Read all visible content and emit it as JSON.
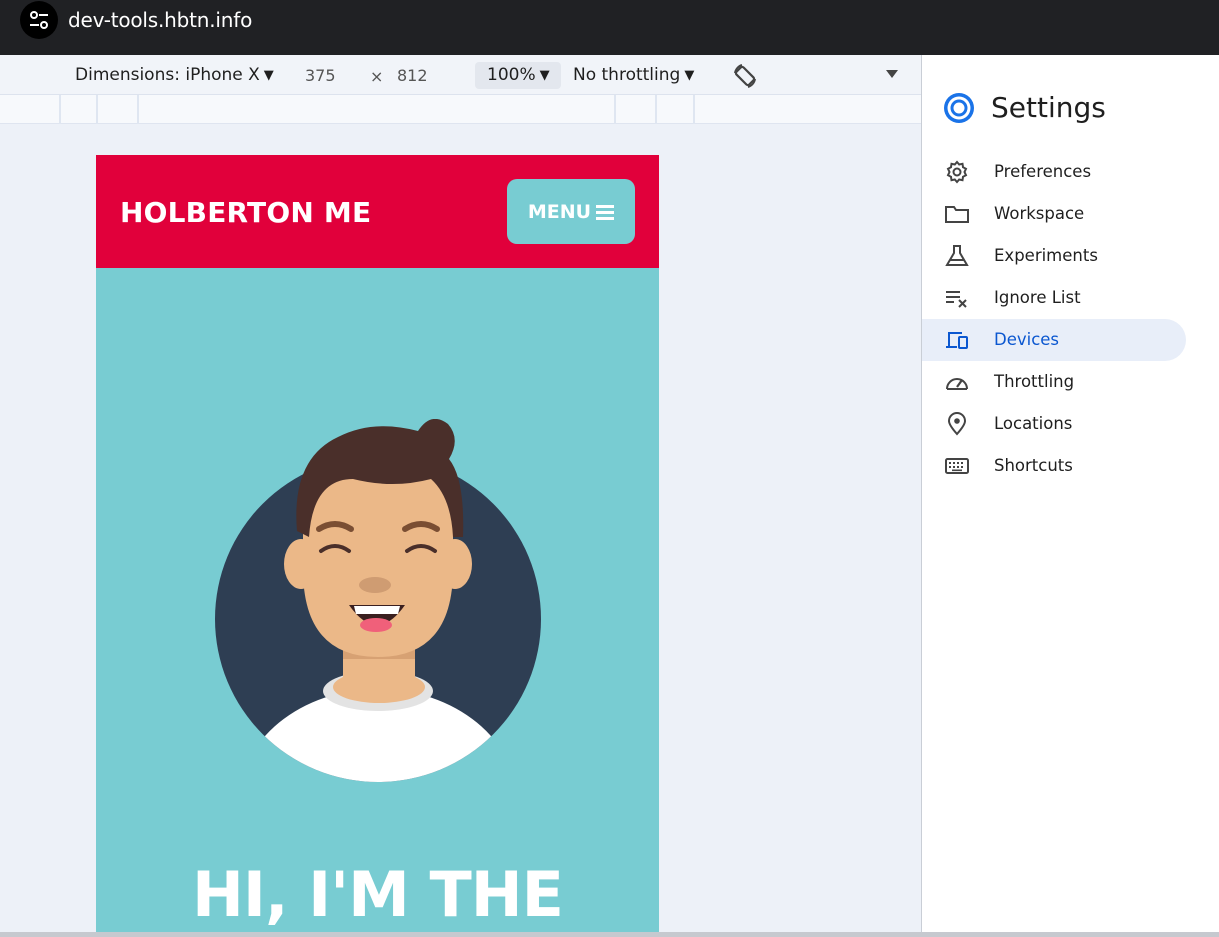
{
  "browser": {
    "url": "dev-tools.hbtn.info",
    "site_icon": "tune-icon"
  },
  "device_toolbar": {
    "dimensions_label": "Dimensions: iPhone X",
    "width": "375",
    "times": "×",
    "height": "812",
    "zoom": "100%",
    "throttling": "No throttling",
    "caret": "▼",
    "rotate_icon": "rotate-icon"
  },
  "page": {
    "logo": "HOLBERTON ME",
    "menu_label": "MENU",
    "hero_title": "HI, I'M THE",
    "colors": {
      "header": "#e1003b",
      "body": "#78ccd2"
    }
  },
  "settings": {
    "title": "Settings",
    "items": [
      {
        "label": "Preferences",
        "icon": "gear-icon"
      },
      {
        "label": "Workspace",
        "icon": "folder-icon"
      },
      {
        "label": "Experiments",
        "icon": "flask-icon"
      },
      {
        "label": "Ignore List",
        "icon": "ignore-list-icon"
      },
      {
        "label": "Devices",
        "icon": "devices-icon",
        "active": true
      },
      {
        "label": "Throttling",
        "icon": "speedometer-icon"
      },
      {
        "label": "Locations",
        "icon": "location-pin-icon"
      },
      {
        "label": "Shortcuts",
        "icon": "keyboard-icon"
      }
    ]
  }
}
